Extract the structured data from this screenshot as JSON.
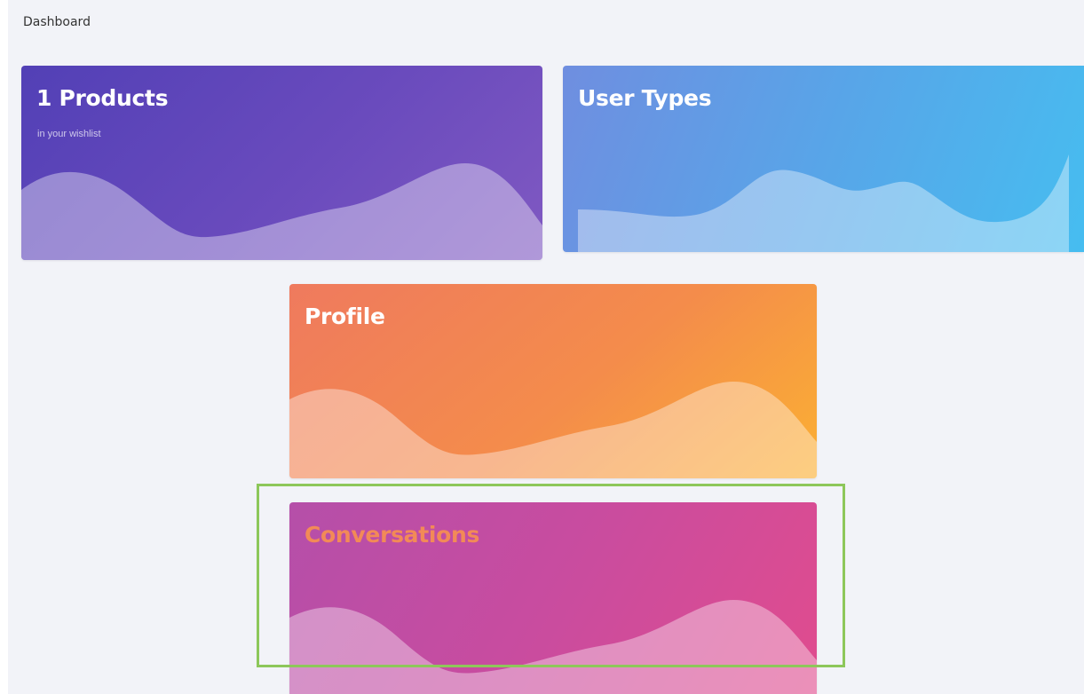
{
  "breadcrumb": "Dashboard",
  "cards": {
    "products": {
      "title": "1 Products",
      "subtitle": "in your wishlist"
    },
    "user_types": {
      "title": "User Types"
    },
    "profile": {
      "title": "Profile"
    },
    "conversations": {
      "title": "Conversations"
    }
  },
  "colors": {
    "background": "#f2f3f8",
    "products_gradient": [
      "#5240b6",
      "#8059c2"
    ],
    "user_types_gradient": [
      "#6f8ee0",
      "#46bdf0"
    ],
    "profile_gradient": [
      "#ef7a5e",
      "#fbb033"
    ],
    "conversations_gradient": [
      "#b54fa9",
      "#e04c8e"
    ],
    "conversations_title": "#f28a57",
    "highlight_border": "#8dc75a"
  }
}
